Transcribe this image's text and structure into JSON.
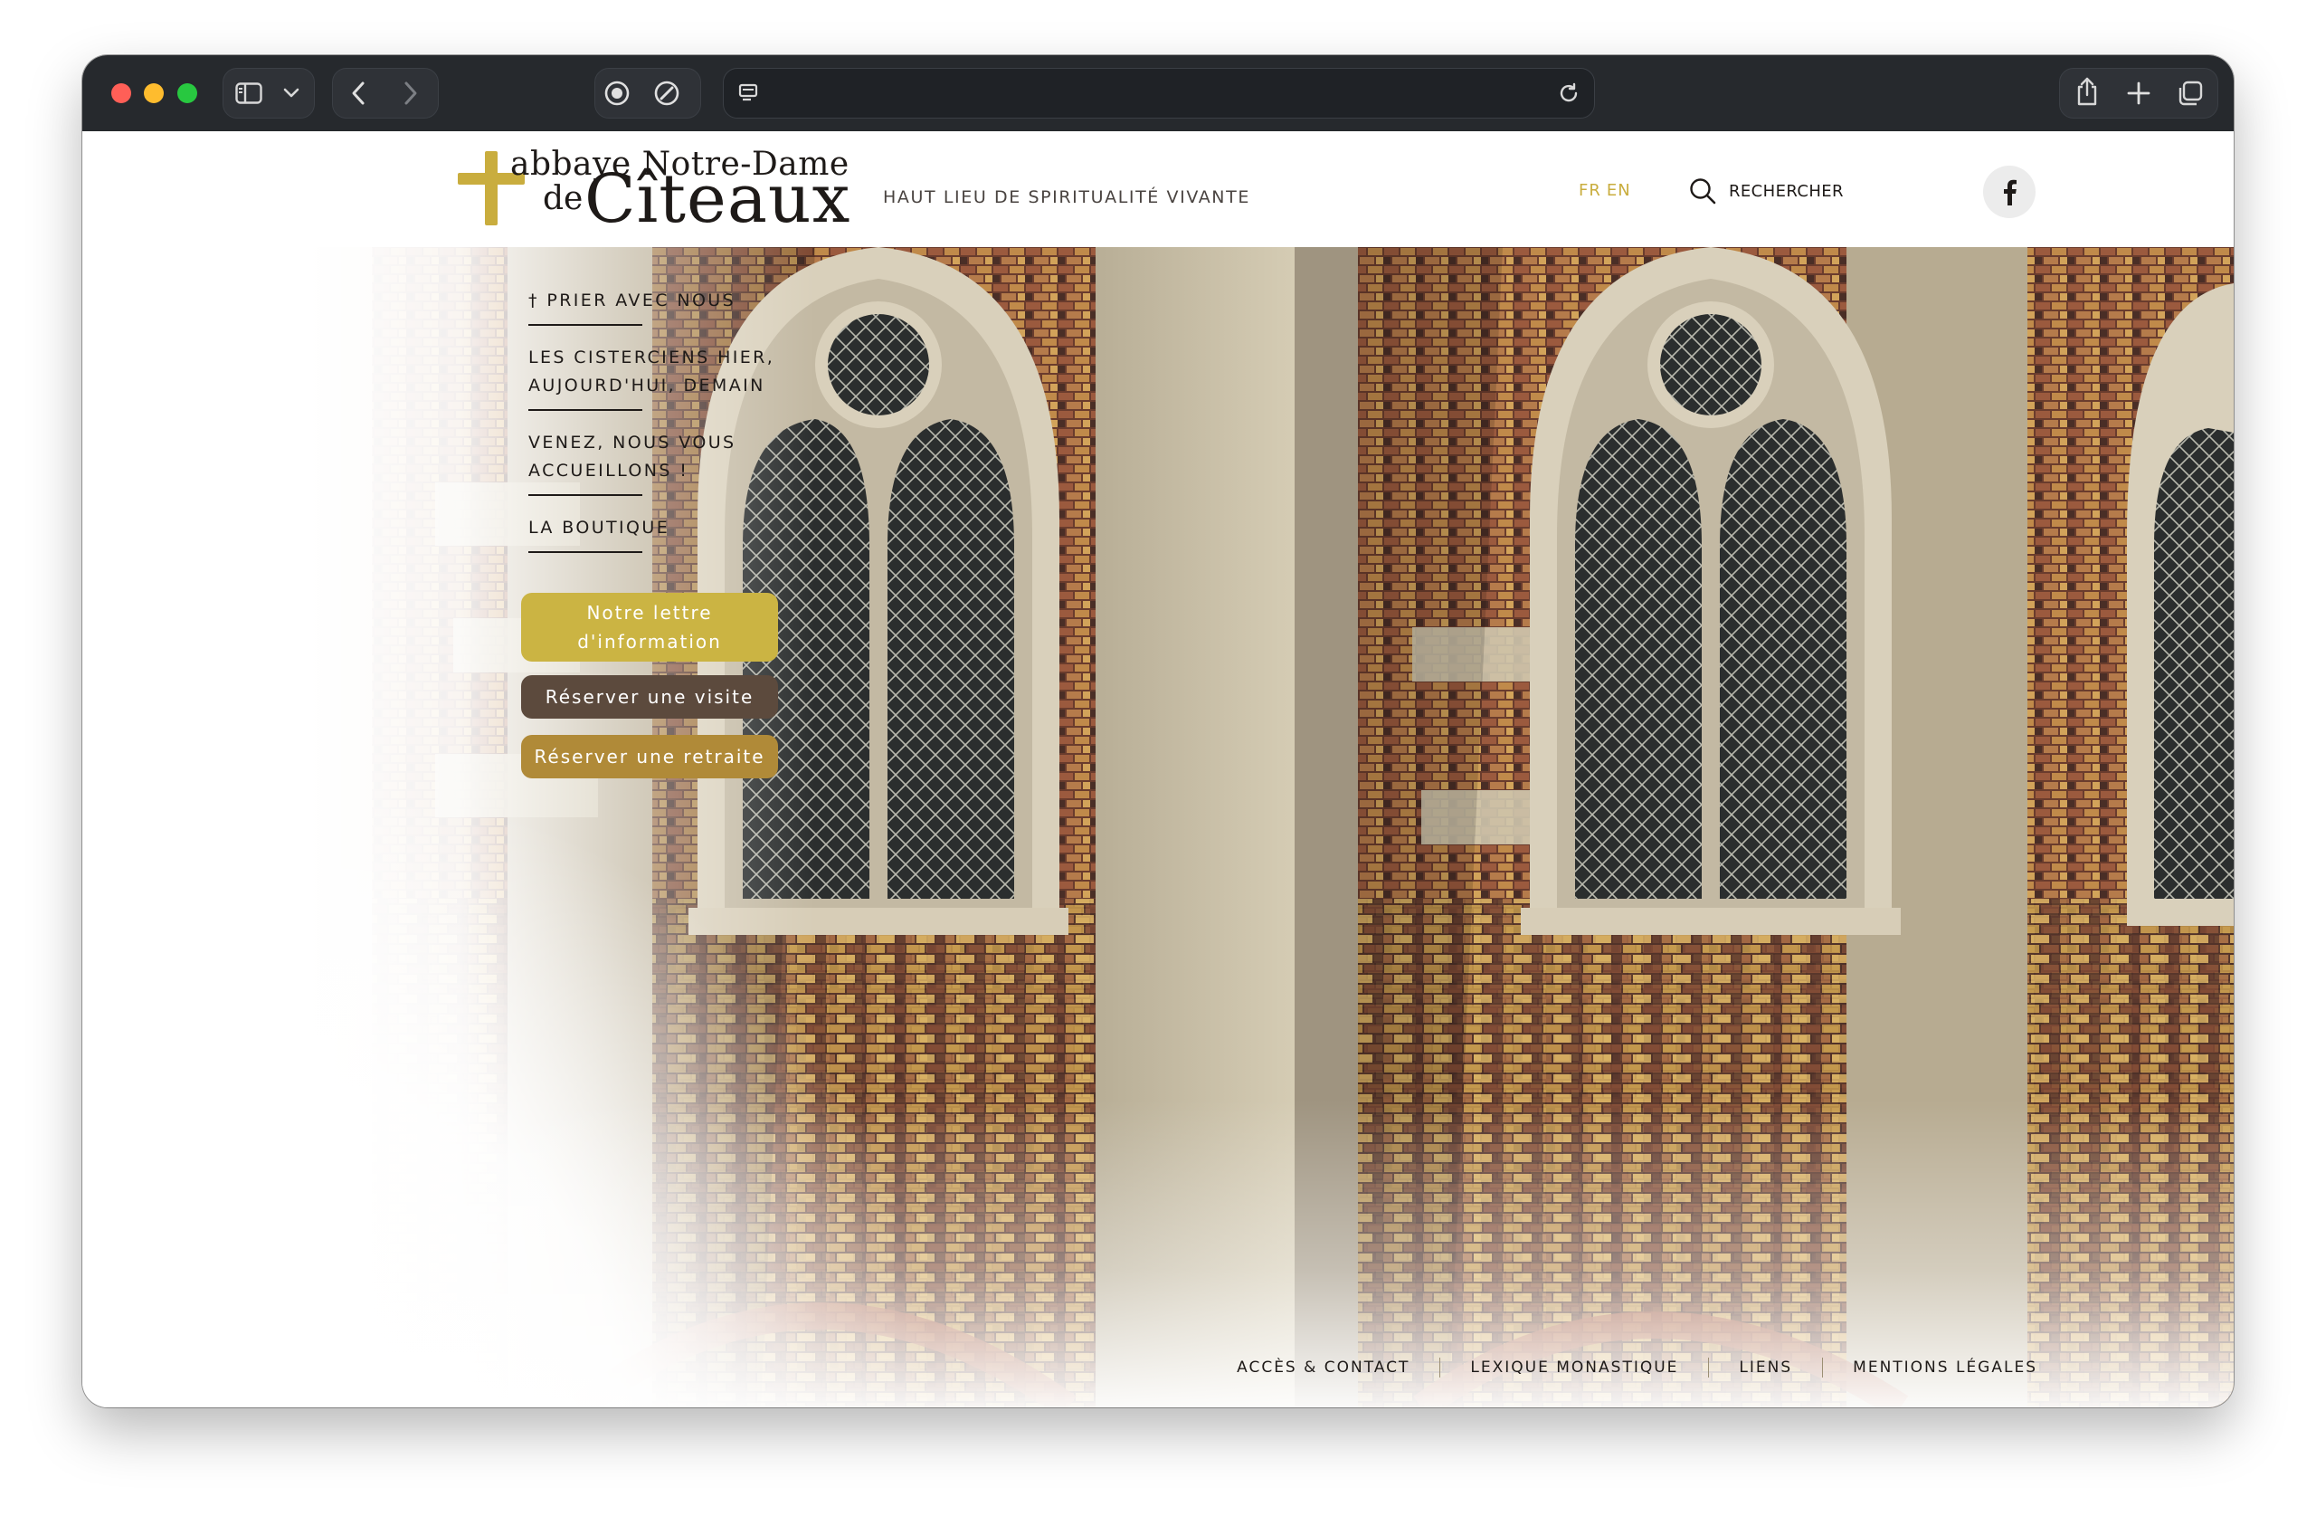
{
  "browser": {
    "icons": [
      "sidebar-icon",
      "chevron-down-icon",
      "back-icon",
      "forward-icon",
      "record-icon",
      "compass-icon",
      "page-icon",
      "reload-icon",
      "share-icon",
      "new-tab-icon",
      "tabs-overview-icon"
    ]
  },
  "site": {
    "logo": {
      "line1": "abbaye Notre-Dame",
      "de": "de",
      "name": "Cîteaux"
    },
    "tagline": "HAUT LIEU DE SPIRITUALITÉ VIVANTE",
    "languages": [
      "FR",
      "EN"
    ],
    "search_label": "RECHERCHER",
    "social": "facebook-icon"
  },
  "nav": {
    "items": [
      {
        "label": "† PRIER AVEC NOUS"
      },
      {
        "label": "LES CISTERCIENS HIER, AUJOURD'HUI, DEMAIN"
      },
      {
        "label": "VENEZ, NOUS VOUS ACCUEILLONS !"
      },
      {
        "label": "LA BOUTIQUE"
      }
    ]
  },
  "buttons": {
    "newsletter": "Notre lettre d'information",
    "visite": "Réserver une visite",
    "retraite": "Réserver une retraite"
  },
  "footer": {
    "links": [
      "ACCÈS & CONTACT",
      "LEXIQUE MONASTIQUE",
      "LIENS",
      "MENTIONS LÉGALES"
    ]
  },
  "colors": {
    "gold": "#c9ad3e",
    "newsletter_bg": "#cbb443",
    "visite_bg": "#5c4a3d",
    "retraite_bg": "#b08a38",
    "titlebar": "#26292d"
  }
}
